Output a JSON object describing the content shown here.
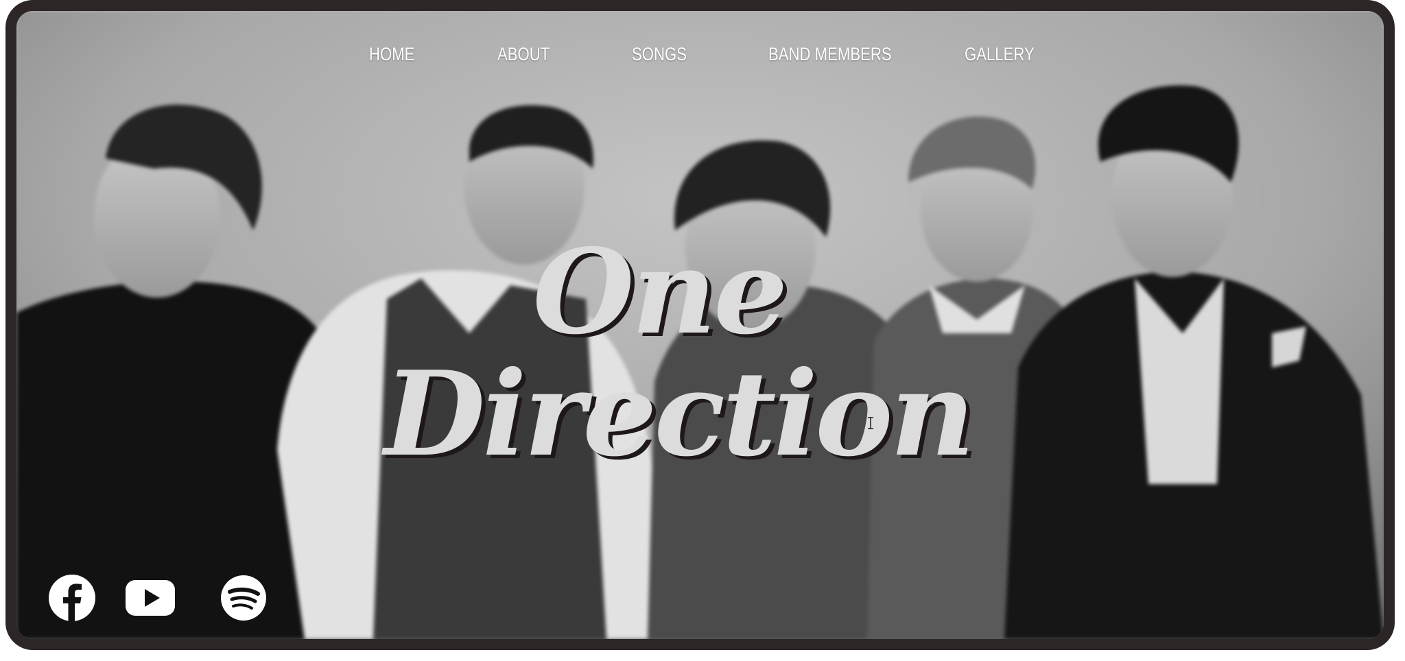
{
  "nav": {
    "items": [
      {
        "label": "HOME"
      },
      {
        "label": "ABOUT"
      },
      {
        "label": "SONGS"
      },
      {
        "label": "BAND MEMBERS"
      },
      {
        "label": "GALLERY"
      }
    ]
  },
  "hero": {
    "title_line1": "One",
    "title_line2": "Direction",
    "photo_icon": "band-photo-black-and-white"
  },
  "social": {
    "items": [
      {
        "icon": "facebook-icon"
      },
      {
        "icon": "youtube-icon"
      },
      {
        "icon": "spotify-icon"
      }
    ]
  },
  "colors": {
    "frame": "#2d2626",
    "title": "#dcdcdc",
    "title_shadow": "#1e1818",
    "nav_text": "#ffffff"
  }
}
